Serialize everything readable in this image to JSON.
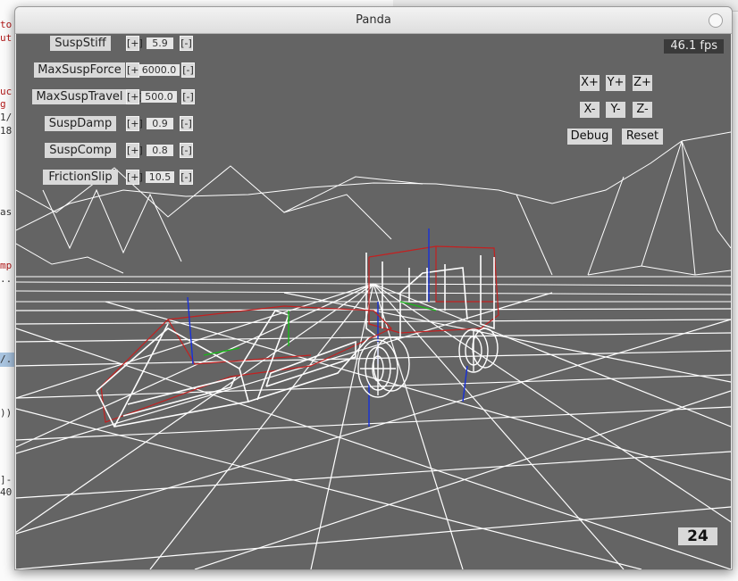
{
  "window": {
    "title": "Panda"
  },
  "background_editor": {
    "lines": [
      "to",
      "ut",
      "uc",
      "g",
      "1/",
      "18",
      "as",
      "mp",
      "..",
      "/.",
      "))",
      "]-",
      "40"
    ]
  },
  "hud": {
    "fps": "46.1 fps",
    "counter": "24"
  },
  "params": [
    {
      "label": "SuspStiff",
      "value": "5.9",
      "plus": "[+]",
      "minus": "[-]"
    },
    {
      "label": "MaxSuspForce",
      "value": "6000.0",
      "plus": "[+]",
      "minus": "[-]"
    },
    {
      "label": "MaxSuspTravel",
      "value": "500.0",
      "plus": "[+]",
      "minus": "[-]"
    },
    {
      "label": "SuspDamp",
      "value": "0.9",
      "plus": "[+]",
      "minus": "[-]"
    },
    {
      "label": "SuspComp",
      "value": "0.8",
      "plus": "[+]",
      "minus": "[-]"
    },
    {
      "label": "FrictionSlip",
      "value": "10.5",
      "plus": "[+]",
      "minus": "[-]"
    }
  ],
  "axis_buttons": {
    "x_plus": "X+",
    "y_plus": "Y+",
    "z_plus": "Z+",
    "x_minus": "X-",
    "y_minus": "Y-",
    "z_minus": "Z-"
  },
  "actions": {
    "debug": "Debug",
    "reset": "Reset"
  },
  "colors": {
    "viewport_bg": "#646464",
    "wire": "#ffffff",
    "chassis_wire": "#c42020",
    "axis_blue": "#1830d8",
    "axis_green": "#18b818"
  }
}
